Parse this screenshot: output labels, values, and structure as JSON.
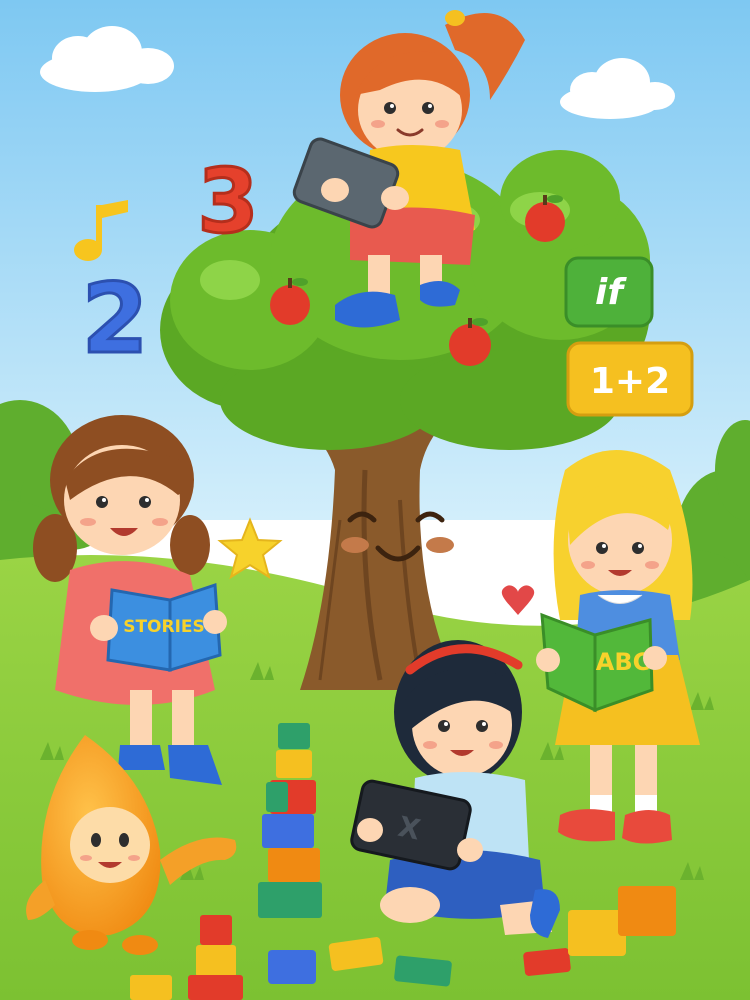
{
  "scene": {
    "colors": {
      "sky_top": "#7EC8F2",
      "sky_bottom": "#CDEBFA",
      "grass": "#8CCB3A",
      "grass_dark": "#6BB22E",
      "foliage": "#6DBB2C",
      "foliage_light": "#8ED448",
      "trunk": "#8A5A2B",
      "apple": "#E23B2A"
    }
  },
  "floating": {
    "num_three": "3",
    "num_two": "2",
    "code_if": "if",
    "math_sum": "1+2"
  },
  "books": {
    "left_cover": "STORIES",
    "right_cover": "ABC"
  },
  "tablets": {
    "bottom_screen_mark": "X"
  }
}
